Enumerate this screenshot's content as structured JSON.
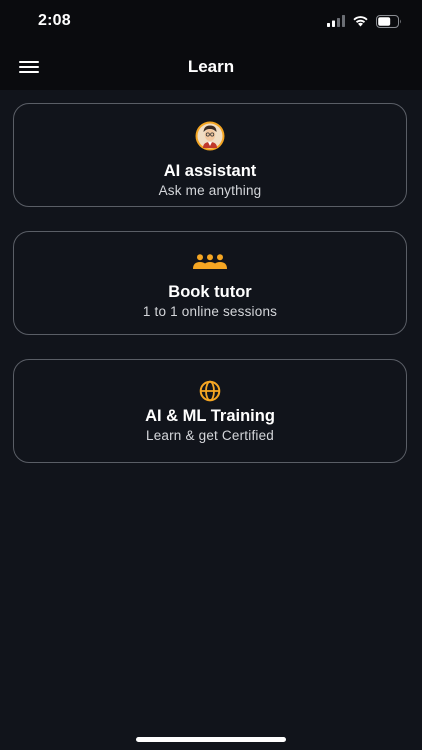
{
  "status": {
    "time": "2:08"
  },
  "header": {
    "title": "Learn",
    "menu_icon": "hamburger-menu-icon"
  },
  "cards": [
    {
      "title": "AI assistant",
      "subtitle": "Ask me anything",
      "icon": "avatar-icon"
    },
    {
      "title": "Book tutor",
      "subtitle": "1 to 1 online sessions",
      "icon": "group-icon"
    },
    {
      "title": "AI & ML Training",
      "subtitle": "Learn & get Certified",
      "icon": "globe-icon"
    }
  ],
  "colors": {
    "background": "#11141b",
    "bar": "#0a0b0e",
    "accent": "#f5a623",
    "card_border": "#5a5e66"
  }
}
